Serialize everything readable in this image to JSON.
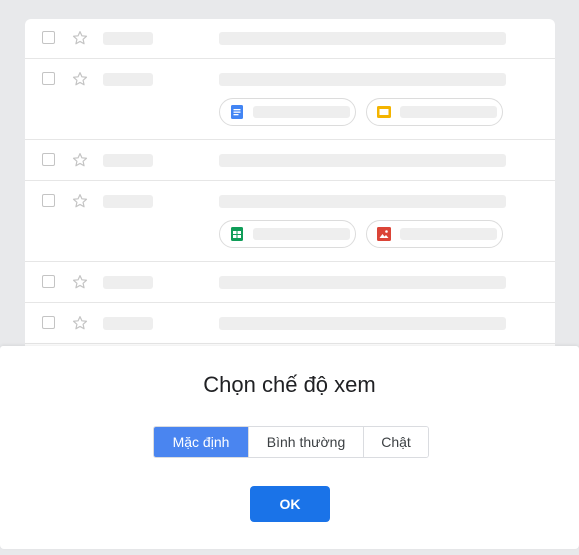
{
  "dialog": {
    "title": "Chọn chế độ xem",
    "options": [
      {
        "label": "Mặc định",
        "selected": true
      },
      {
        "label": "Bình thường",
        "selected": false
      },
      {
        "label": "Chật",
        "selected": false
      }
    ],
    "ok_label": "OK"
  },
  "preview": {
    "rows": 6,
    "attachments": [
      "docs-icon",
      "slides-icon",
      "sheets-icon",
      "photo-icon"
    ]
  },
  "colors": {
    "accent": "#1a73e8",
    "selected_option": "#4a85f0",
    "docs": "#4285f4",
    "slides": "#f4b400",
    "sheets": "#0f9d58",
    "photo": "#db4437"
  }
}
